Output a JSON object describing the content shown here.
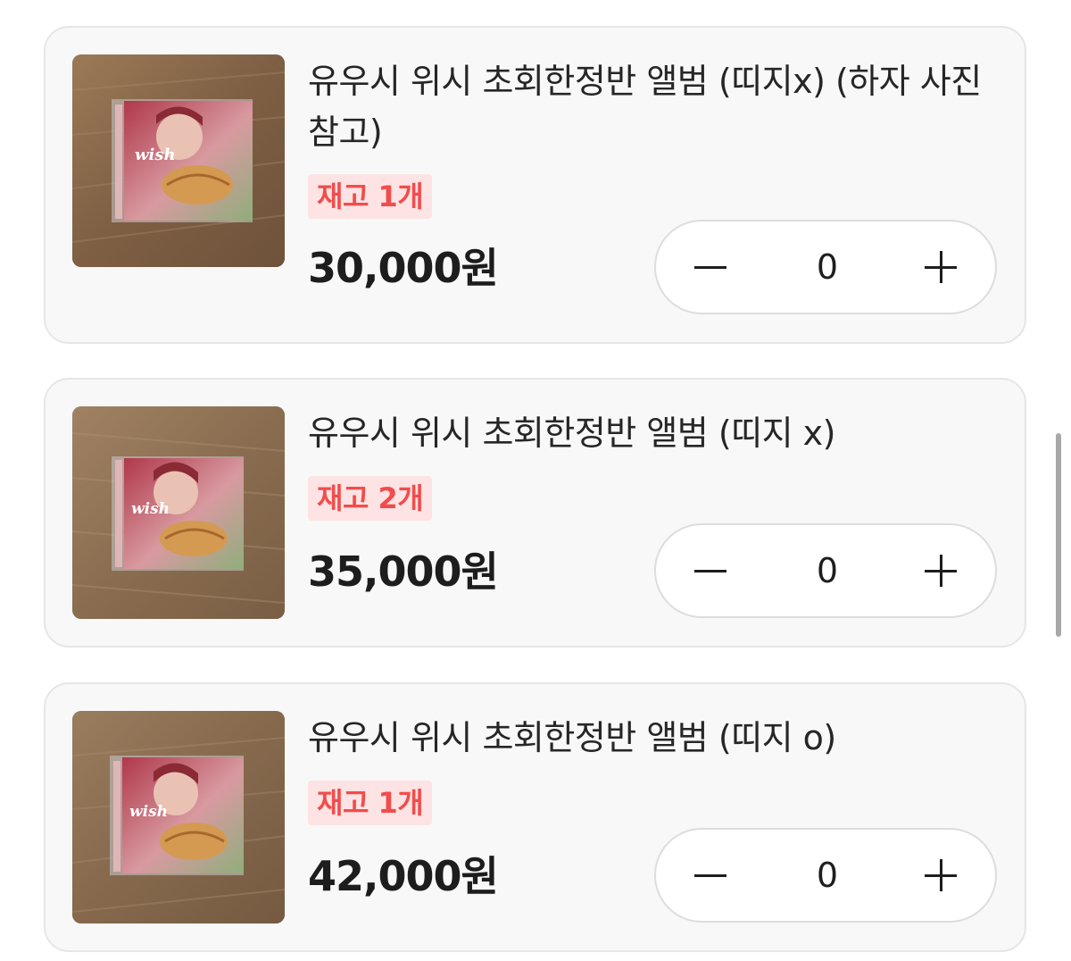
{
  "products": [
    {
      "title": "유우시 위시 초회한정반 앨범 (띠지x) (하자 사진 참고)",
      "stock": "재고 1개",
      "price": "30,000원",
      "quantity": "0",
      "image_icon": "album-photo"
    },
    {
      "title": "유우시 위시 초회한정반 앨범 (띠지 x)",
      "stock": "재고 2개",
      "price": "35,000원",
      "quantity": "0",
      "image_icon": "album-photo"
    },
    {
      "title": "유우시 위시 초회한정반 앨범 (띠지 o)",
      "stock": "재고 1개",
      "price": "42,000원",
      "quantity": "0",
      "image_icon": "album-photo"
    }
  ],
  "stepper": {
    "minus_icon": "minus-icon",
    "plus_icon": "plus-icon"
  },
  "colors": {
    "card_background": "#f9f8f8",
    "card_border": "#e6e6e6",
    "stock_background": "#fde3e3",
    "stock_text": "#f24c4c",
    "price_text": "#1d1d1d"
  }
}
